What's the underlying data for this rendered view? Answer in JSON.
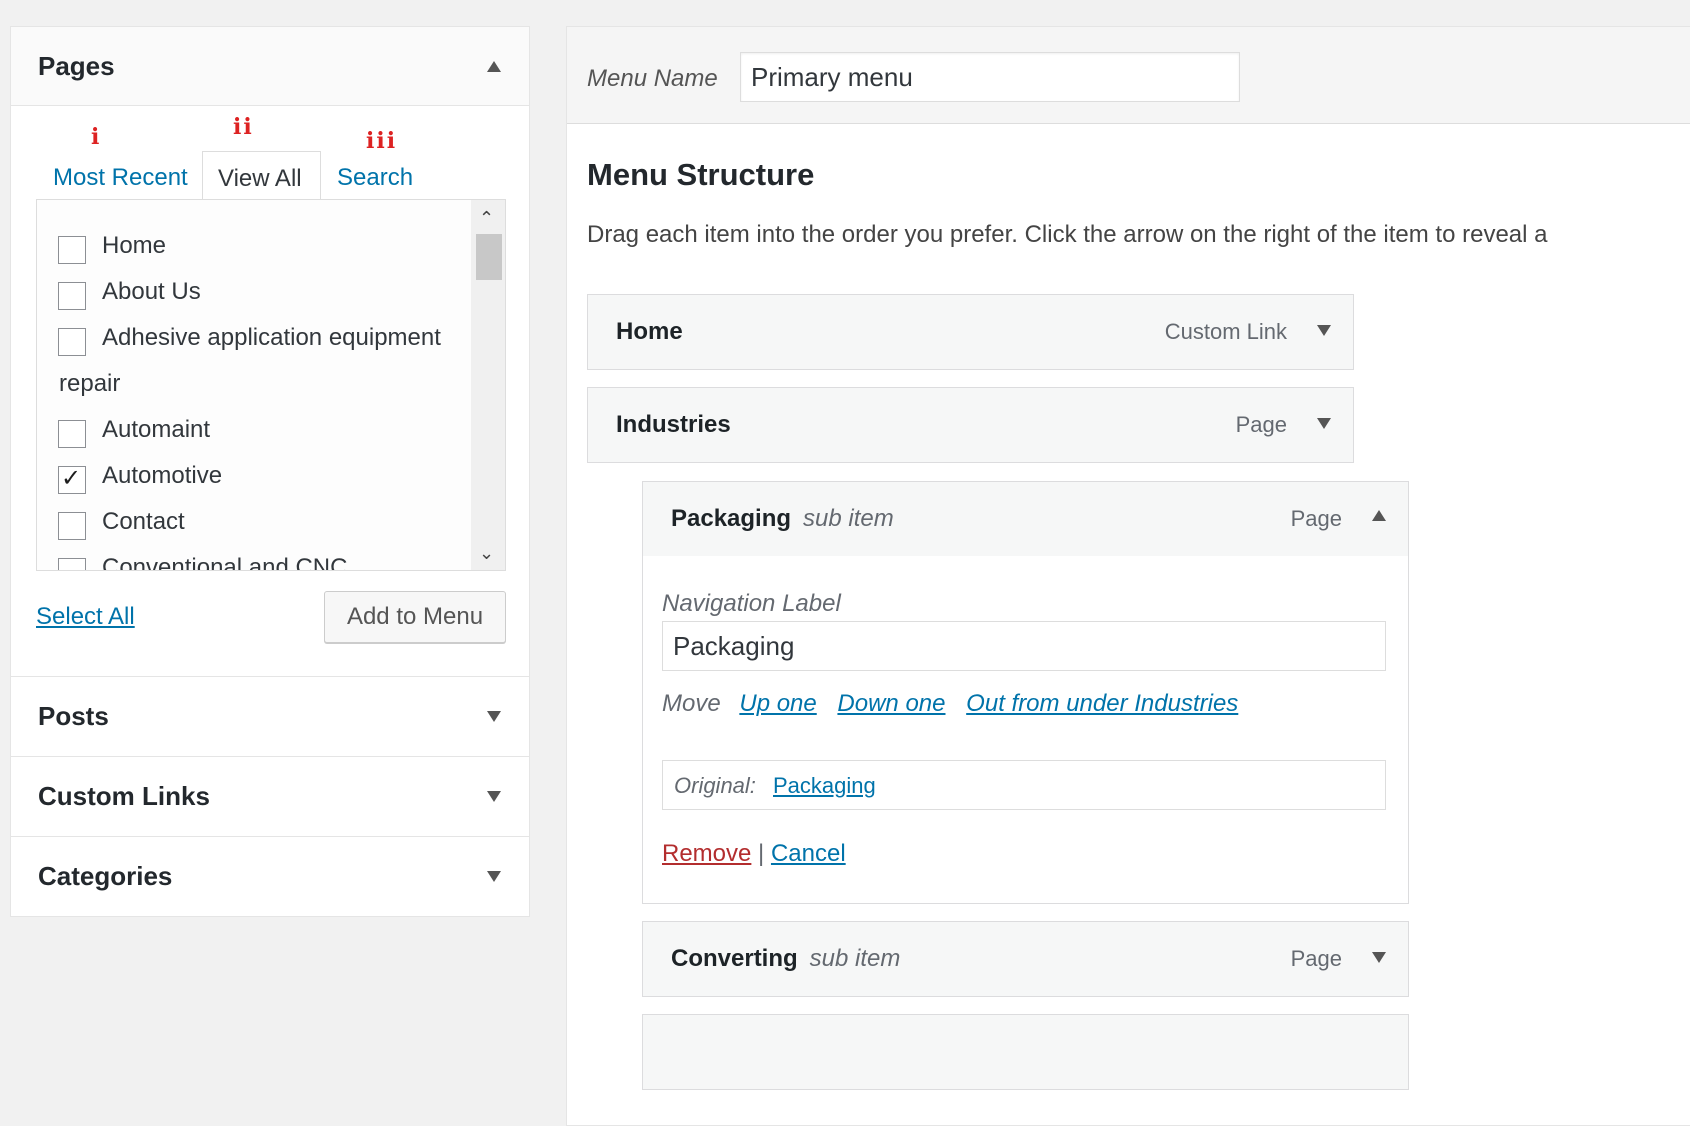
{
  "colors": {
    "link": "#0073aa",
    "danger": "#b32d2e",
    "annotation": "#d22222",
    "panel_bg": "#f1f1f1"
  },
  "sidebar": {
    "pages": {
      "title": "Pages",
      "tabs": [
        {
          "label": "Most Recent",
          "active": false,
          "annotation": "i"
        },
        {
          "label": "View All",
          "active": true,
          "annotation": "ii"
        },
        {
          "label": "Search",
          "active": false,
          "annotation": "iii"
        }
      ],
      "items": [
        {
          "label": "Home",
          "checked": false
        },
        {
          "label": "About Us",
          "checked": false
        },
        {
          "label": "Adhesive application equipment",
          "label_wrap": "repair",
          "checked": false
        },
        {
          "label": "Automaint",
          "checked": false
        },
        {
          "label": "Automotive",
          "checked": true
        },
        {
          "label": "Contact",
          "checked": false
        },
        {
          "label": "Conventional and CNC",
          "checked": false
        }
      ],
      "select_all": "Select All",
      "add_button": "Add to Menu"
    },
    "sections": [
      {
        "title": "Posts"
      },
      {
        "title": "Custom Links"
      },
      {
        "title": "Categories"
      }
    ]
  },
  "menu": {
    "name_label": "Menu Name",
    "name_value": "Primary menu",
    "structure_title": "Menu Structure",
    "structure_desc": "Drag each item into the order you prefer. Click the arrow on the right of the item to reveal a",
    "items": [
      {
        "title": "Home",
        "type": "Custom Link",
        "sub": ""
      },
      {
        "title": "Industries",
        "type": "Page",
        "sub": ""
      },
      {
        "title": "Packaging",
        "type": "Page",
        "sub": "sub item"
      },
      {
        "title": "Converting",
        "type": "Page",
        "sub": "sub item"
      }
    ],
    "expanded": {
      "nav_label_caption": "Navigation Label",
      "nav_label_value": "Packaging",
      "move_label": "Move",
      "move_links": [
        "Up one",
        "Down one",
        "Out from under Industries"
      ],
      "original_label": "Original:",
      "original_link": "Packaging",
      "remove": "Remove",
      "separator": "|",
      "cancel": "Cancel"
    }
  }
}
